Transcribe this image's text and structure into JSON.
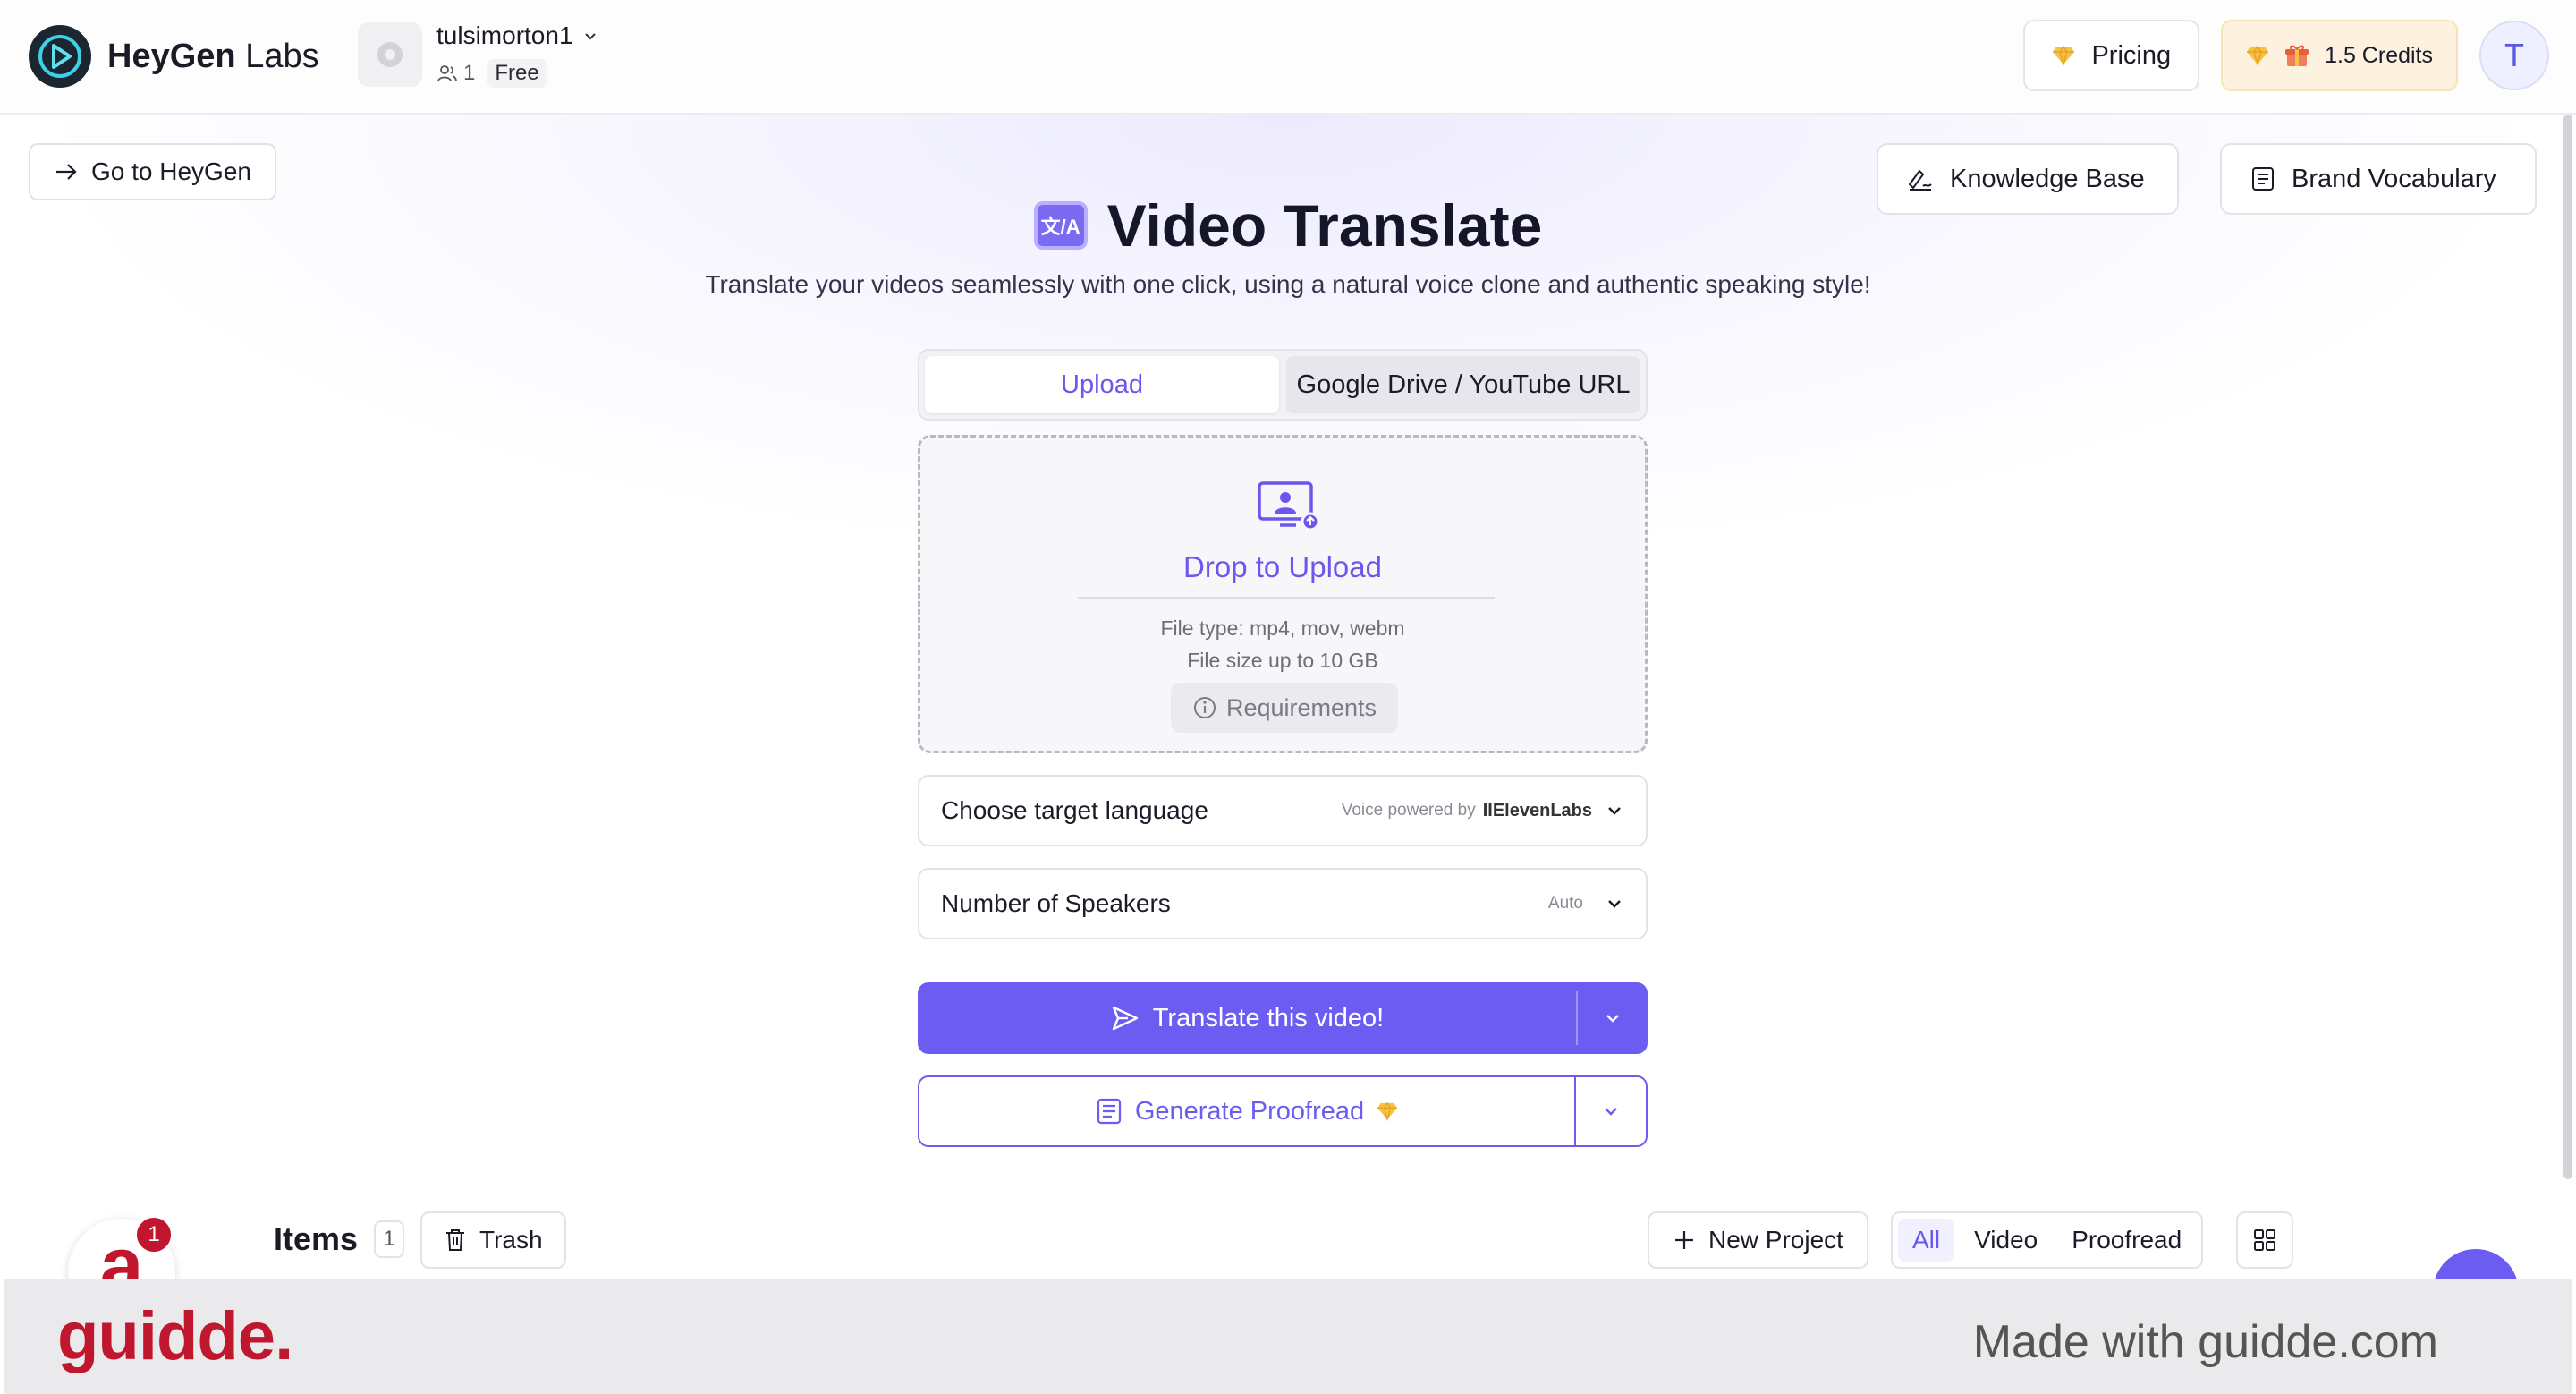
{
  "brand": {
    "name_bold": "HeyGen",
    "name_light": "Labs"
  },
  "workspace": {
    "name": "tulsimorton1",
    "members": "1",
    "plan": "Free"
  },
  "nav": {
    "pricing_label": "Pricing",
    "credits_label": "1.5 Credits",
    "avatar_letter": "T"
  },
  "actions": {
    "go_heygen": "Go to HeyGen",
    "knowledge_base": "Knowledge Base",
    "brand_vocabulary": "Brand Vocabulary"
  },
  "header": {
    "icon_text": "文/A",
    "title": "Video Translate",
    "subtitle": "Translate your videos seamlessly with one click, using a natural voice clone and authentic speaking style!"
  },
  "tabs": [
    {
      "label": "Upload",
      "active": true
    },
    {
      "label": "Google Drive / YouTube URL",
      "active": false
    }
  ],
  "upload": {
    "title": "Drop to Upload",
    "file_type": "File type: mp4, mov, webm",
    "file_size": "File size up to 10 GB",
    "requirements": "Requirements"
  },
  "language_select": {
    "label": "Choose target language",
    "hint_prefix": "Voice powered by",
    "hint_brand": "IIElevenLabs"
  },
  "speakers_select": {
    "label": "Number of Speakers",
    "hint": "Auto"
  },
  "buttons": {
    "translate": "Translate this video!",
    "proofread": "Generate Proofread"
  },
  "items": {
    "title": "Items",
    "count": "1",
    "trash": "Trash",
    "new_project": "New Project",
    "filters": [
      "All",
      "Video",
      "Proofread"
    ],
    "active_filter": "All"
  },
  "guidde": {
    "badge": "1",
    "logo": "guidde.",
    "made_with": "Made with guidde.com"
  },
  "colors": {
    "accent": "#6c5cf2",
    "guidde_red": "#c0172f",
    "credits_bg": "#fdf2df"
  }
}
